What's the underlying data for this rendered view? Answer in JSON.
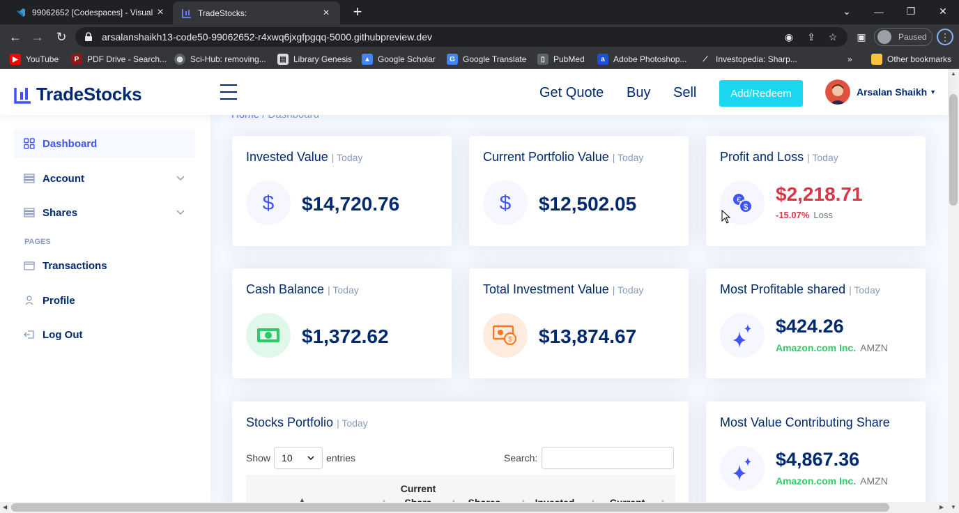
{
  "browser": {
    "tabs": [
      {
        "title": "99062652 [Codespaces] - Visual S",
        "active": false
      },
      {
        "title": "TradeStocks:",
        "active": true
      }
    ],
    "url": "arsalanshaikh13-code50-99062652-r4xwq6jxgfpgqq-5000.githubpreview.dev",
    "profile_status": "Paused",
    "bookmarks": [
      {
        "label": "YouTube",
        "icon": "youtube-icon",
        "color": "#ff0000"
      },
      {
        "label": "PDF Drive - Search...",
        "icon": "pdf-icon",
        "color": "#8b1a1a"
      },
      {
        "label": "Sci-Hub: removing...",
        "icon": "globe-icon",
        "color": "#5f6368"
      },
      {
        "label": "Library Genesis",
        "icon": "book-icon",
        "color": "#9aa0a6"
      },
      {
        "label": "Google Scholar",
        "icon": "scholar-icon",
        "color": "#4285f4"
      },
      {
        "label": "Google Translate",
        "icon": "translate-icon",
        "color": "#4285f4"
      },
      {
        "label": "PubMed",
        "icon": "doc-icon",
        "color": "#5f6368"
      },
      {
        "label": "Adobe Photoshop...",
        "icon": "adobe-icon",
        "color": "#1f4fd8"
      },
      {
        "label": "Investopedia: Sharp...",
        "icon": "investopedia-icon",
        "color": "#e8eaed"
      }
    ],
    "other_bookmarks": "Other bookmarks"
  },
  "app": {
    "brand": "TradeStocks",
    "nav": [
      "Get Quote",
      "Buy",
      "Sell"
    ],
    "cta": "Add/Redeem",
    "user": "Arsalan Shaikh",
    "accent": "#4154f1",
    "primary_text": "#012970"
  },
  "sidebar": {
    "items": [
      {
        "label": "Dashboard",
        "icon": "grid-icon",
        "active": true
      },
      {
        "label": "Account",
        "icon": "stack-icon",
        "expandable": true
      },
      {
        "label": "Shares",
        "icon": "stack-icon",
        "expandable": true
      }
    ],
    "pages_heading": "PAGES",
    "pages": [
      {
        "label": "Transactions",
        "icon": "card-icon"
      },
      {
        "label": "Profile",
        "icon": "person-icon"
      },
      {
        "label": "Log Out",
        "icon": "logout-icon"
      }
    ]
  },
  "breadcrumb": {
    "home": "Home",
    "sep": "/",
    "current": "Dashboard"
  },
  "cards": {
    "invested": {
      "title": "Invested Value",
      "sub": "| Today",
      "value": "$14,720.76",
      "icon": "dollar-icon"
    },
    "current": {
      "title": "Current Portfolio Value",
      "sub": "| Today",
      "value": "$12,502.05",
      "icon": "dollar-icon"
    },
    "pnl": {
      "title": "Profit and Loss",
      "sub": "| Today",
      "value": "$2,218.71",
      "pct": "-15.07%",
      "label": "Loss",
      "icon": "currency-exchange-icon",
      "color": "#dc3545"
    },
    "cash": {
      "title": "Cash Balance",
      "sub": "| Today",
      "value": "$1,372.62",
      "icon": "cash-icon"
    },
    "total": {
      "title": "Total Investment Value",
      "sub": "| Today",
      "value": "$13,874.67",
      "icon": "cash-coin-icon"
    },
    "profitable": {
      "title": "Most Profitable shared",
      "sub": "| Today",
      "value": "$424.26",
      "company": "Amazon.com Inc.",
      "symbol": "AMZN",
      "icon": "stars-icon"
    },
    "contributing": {
      "title": "Most Value Contributing Share",
      "value": "$4,867.36",
      "company": "Amazon.com Inc.",
      "symbol": "AMZN",
      "icon": "stars-icon"
    }
  },
  "portfolio": {
    "title": "Stocks Portfolio",
    "sub": "| Today",
    "show": "Show",
    "entries_value": "10",
    "entries": "entries",
    "search_label": "Search:",
    "columns": [
      "",
      "Current Share",
      "Shares",
      "Invested",
      "Current"
    ]
  }
}
